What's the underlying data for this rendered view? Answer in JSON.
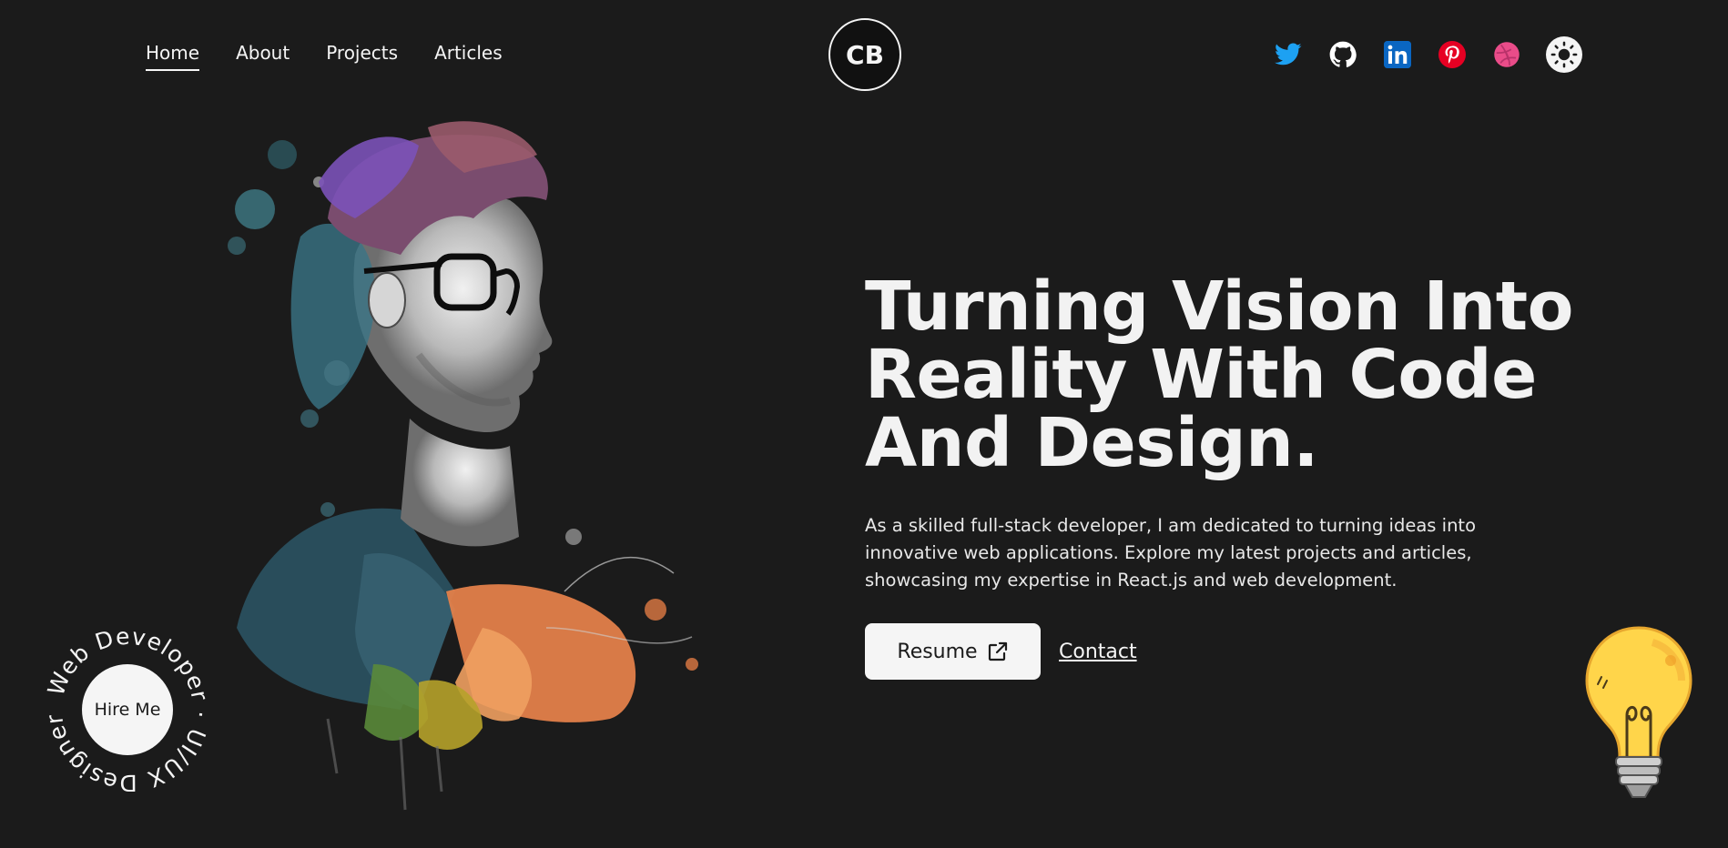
{
  "nav": {
    "links": [
      {
        "label": "Home",
        "active": true
      },
      {
        "label": "About",
        "active": false
      },
      {
        "label": "Projects",
        "active": false
      },
      {
        "label": "Articles",
        "active": false
      }
    ],
    "logo": "CB",
    "socials": [
      {
        "name": "twitter-icon",
        "color": "#1da1f2"
      },
      {
        "name": "github-icon",
        "color": "#ffffff"
      },
      {
        "name": "linkedin-icon",
        "color": "#0a66c2"
      },
      {
        "name": "pinterest-icon",
        "color": "#e60023"
      },
      {
        "name": "dribbble-icon",
        "color": "#ea4c89"
      }
    ],
    "theme_toggle": "sun-icon"
  },
  "hero": {
    "headline": "Turning Vision Into Reality With Code And Design.",
    "intro": "As a skilled full-stack developer, I am dedicated to turning ideas into innovative web applications. Explore my latest projects and articles, showcasing my expertise in React.js and web development.",
    "resume_label": "Resume",
    "contact_label": "Contact"
  },
  "hire": {
    "label": "Hire Me",
    "ring_text": "Web Developer · UI/UX Designer ·"
  },
  "colors": {
    "background": "#1b1b1b",
    "text": "#f5f5f5",
    "bulb": "#ffd54a"
  }
}
